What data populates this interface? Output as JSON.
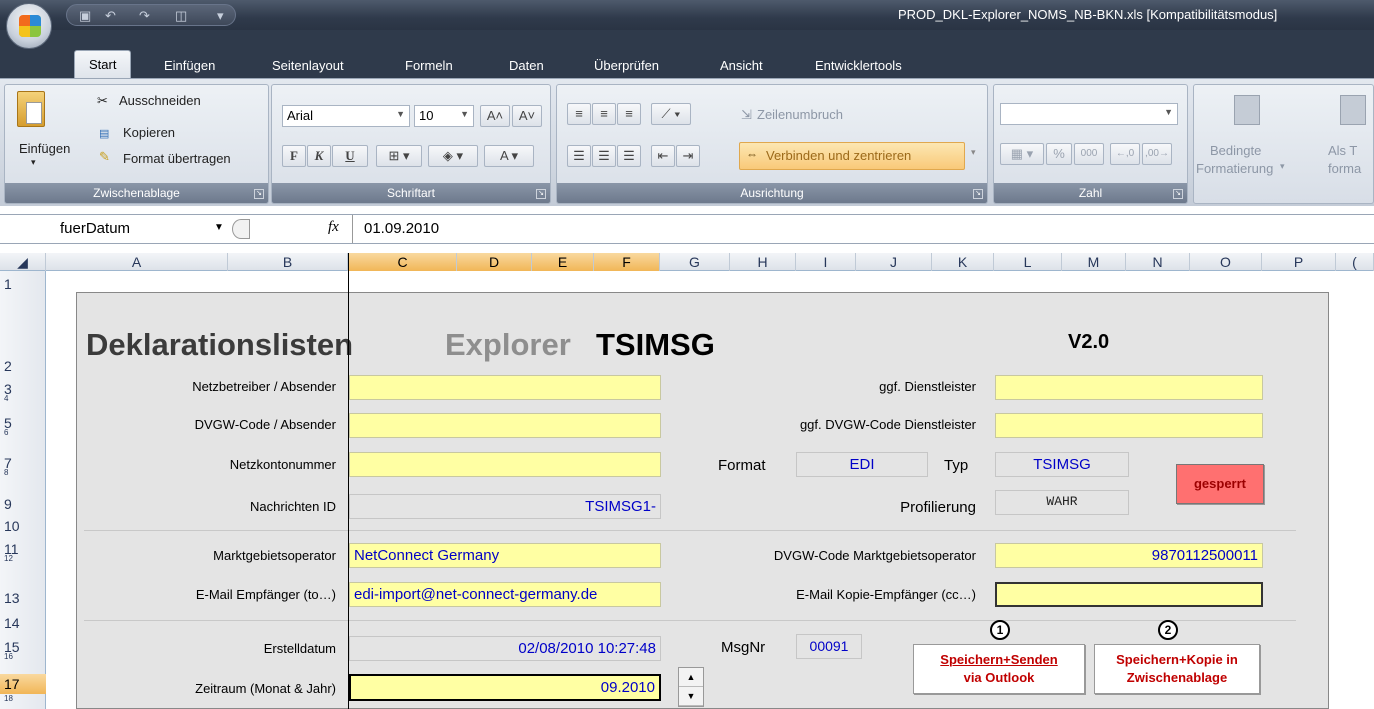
{
  "window": {
    "title": "PROD_DKL-Explorer_NOMS_NB-BKN.xls  [Kompatibilitätsmodus]"
  },
  "tabs": [
    "Start",
    "Einfügen",
    "Seitenlayout",
    "Formeln",
    "Daten",
    "Überprüfen",
    "Ansicht",
    "Entwicklertools"
  ],
  "ribbon": {
    "clipboard": {
      "paste": "Einfügen",
      "cut": "Ausschneiden",
      "copy": "Kopieren",
      "format_painter": "Format übertragen",
      "label": "Zwischenablage"
    },
    "font": {
      "name": "Arial",
      "size": "10",
      "bold": "F",
      "italic": "K",
      "underline": "U",
      "label": "Schriftart"
    },
    "alignment": {
      "wrap": "Zeilenumbruch",
      "merge": "Verbinden und zentrieren",
      "label": "Ausrichtung"
    },
    "number": {
      "label": "Zahl",
      "percent": "%",
      "thousands": "000"
    },
    "styles": {
      "cond_format": "Bedingte",
      "cond_format2": "Formatierung",
      "as_table": "Als T",
      "as_table2": "forma"
    }
  },
  "formula_bar": {
    "name_box": "fuerDatum",
    "fx": "fx",
    "value": "01.09.2010"
  },
  "columns": [
    "A",
    "B",
    "C",
    "D",
    "E",
    "F",
    "G",
    "H",
    "I",
    "J",
    "K",
    "L",
    "M",
    "N",
    "O",
    "P",
    "("
  ],
  "rows": [
    "1",
    "2",
    "3",
    "4",
    "5",
    "6",
    "7",
    "8",
    "9",
    "10",
    "11",
    "12",
    "13",
    "14",
    "15",
    "16",
    "17",
    "18"
  ],
  "form": {
    "title_part1": "Deklarationslisten",
    "title_part2": "Explorer",
    "title_part3": "TSIMSG",
    "version": "V2.0",
    "labels": {
      "netzbetreiber": "Netzbetreiber / Absender",
      "dvgw_code": "DVGW-Code / Absender",
      "netzkonto": "Netzkontonummer",
      "nachrichten_id": "Nachrichten ID",
      "dienstleister": "ggf. Dienstleister",
      "dvgw_dienstleister": "ggf. DVGW-Code Dienstleister",
      "format": "Format",
      "typ": "Typ",
      "profilierung": "Profilierung",
      "marktgebiet": "Marktgebietsoperator",
      "email_to": "E-Mail Empfänger (to…)",
      "dvgw_marktgebiet": "DVGW-Code Marktgebietsoperator",
      "email_cc": "E-Mail Kopie-Empfänger (cc…)",
      "erstelldatum": "Erstelldatum",
      "msgnr": "MsgNr",
      "zeitraum": "Zeitraum (Monat & Jahr)"
    },
    "values": {
      "nachrichten_id": "TSIMSG1-",
      "format": "EDI",
      "typ": "TSIMSG",
      "profilierung": "WAHR",
      "marktgebiet": "NetConnect Germany",
      "email_to": "edi-import@net-connect-germany.de",
      "dvgw_marktgebiet": "9870112500011",
      "erstelldatum": "02/08/2010 10:27:48",
      "msgnr": "00091",
      "zeitraum": "09.2010"
    },
    "buttons": {
      "locked": "gesperrt",
      "send_line1": "Speichern+Senden",
      "send_line2": "via Outlook",
      "copy_line1": "Speichern+Kopie in",
      "copy_line2": "Zwischenablage",
      "num1": "1",
      "num2": "2"
    }
  }
}
